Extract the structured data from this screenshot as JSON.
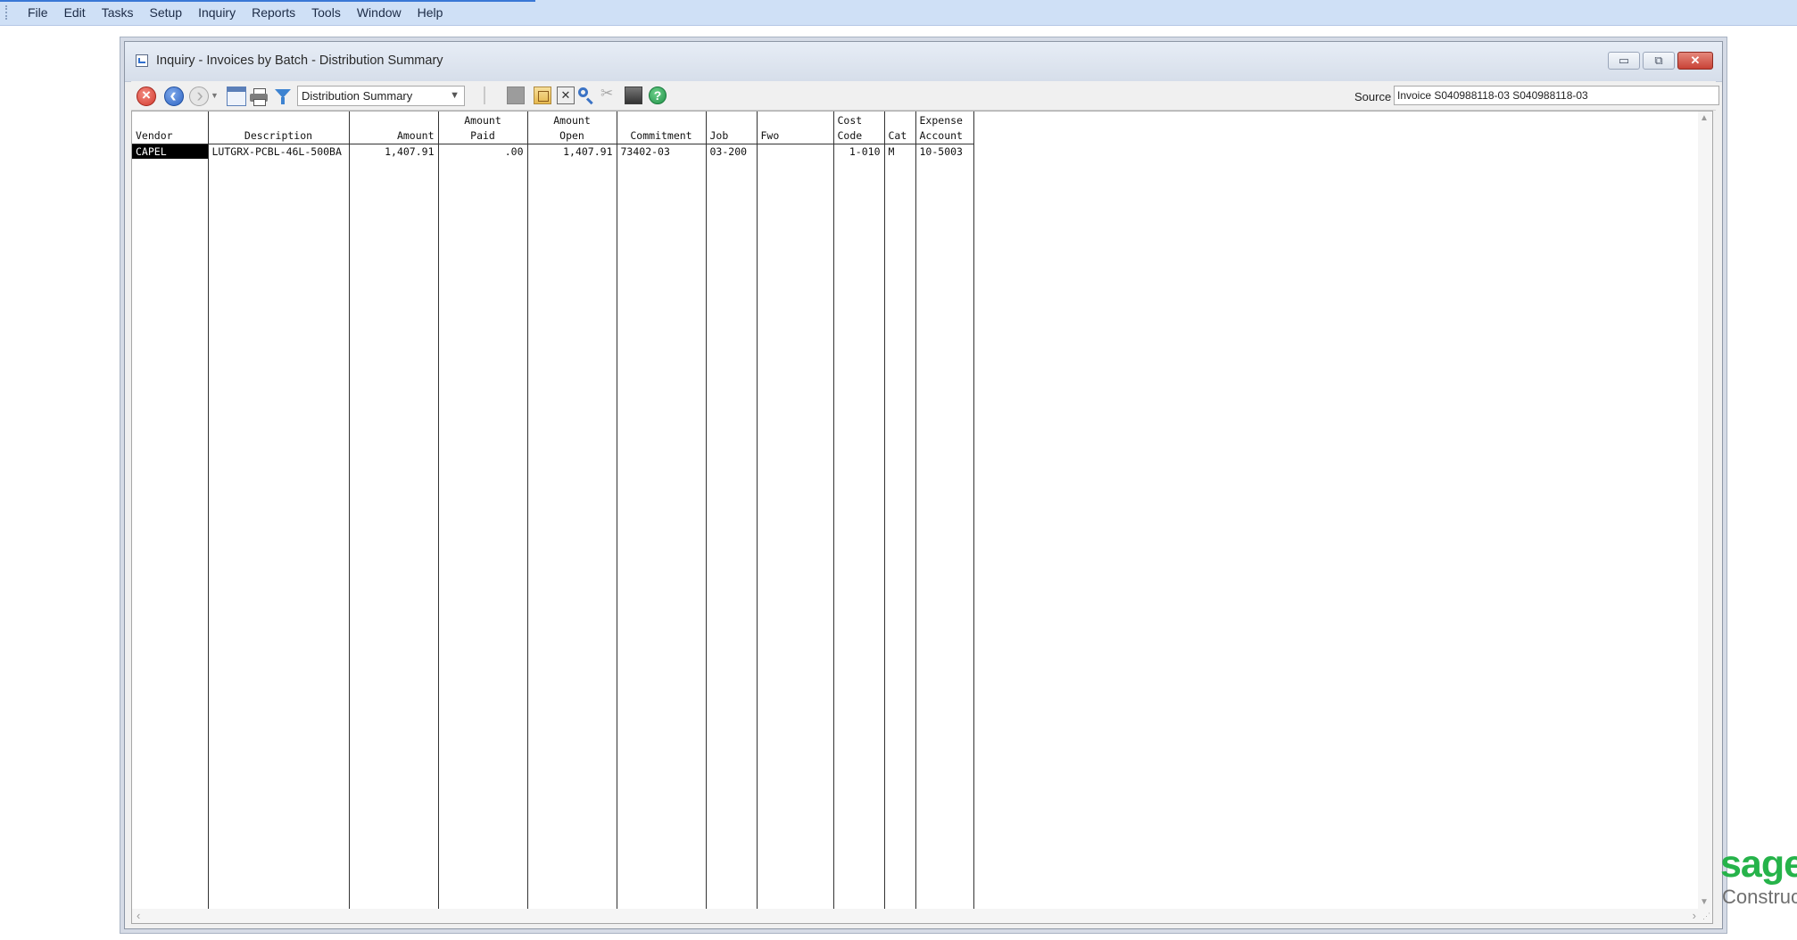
{
  "menubar": {
    "items": [
      "File",
      "Edit",
      "Tasks",
      "Setup",
      "Inquiry",
      "Reports",
      "Tools",
      "Window",
      "Help"
    ]
  },
  "window": {
    "title": "Inquiry - Invoices by Batch - Distribution Summary",
    "buttons": {
      "minimize": "▭",
      "maximize": "⧉",
      "close": "✕"
    }
  },
  "toolbar": {
    "view_selector": "Distribution Summary",
    "source_label": "Source",
    "source_value": "Invoice S040988118-03  S040988118-03"
  },
  "grid": {
    "columns": [
      {
        "line1": "",
        "line2": "Vendor",
        "align": "left"
      },
      {
        "line1": "",
        "line2": "Description",
        "align": "center"
      },
      {
        "line1": "",
        "line2": "Amount",
        "align": "right"
      },
      {
        "line1": "Amount",
        "line2": "Paid",
        "align": "center"
      },
      {
        "line1": "Amount",
        "line2": "Open",
        "align": "center"
      },
      {
        "line1": "",
        "line2": "Commitment",
        "align": "center"
      },
      {
        "line1": "",
        "line2": "Job",
        "align": "left"
      },
      {
        "line1": "",
        "line2": "Fwo",
        "align": "left"
      },
      {
        "line1": "Cost",
        "line2": "Code",
        "align": "left"
      },
      {
        "line1": "",
        "line2": "Cat",
        "align": "left"
      },
      {
        "line1": "Expense",
        "line2": "Account",
        "align": "left"
      }
    ],
    "rows": [
      [
        "CAPEL",
        "LUTGRX-PCBL-46L-500BA",
        "1,407.91",
        ".00",
        "1,407.91",
        "73402-03",
        "03-200",
        "",
        "1-010",
        "M",
        "10-5003"
      ]
    ]
  },
  "logo": {
    "brand": "sage",
    "subtext": "Construct"
  },
  "colors": {
    "menubar": "#cfe0f6",
    "window_frame": "#d5dbe6",
    "logo_green": "#26b34a",
    "selection": "#000000"
  }
}
